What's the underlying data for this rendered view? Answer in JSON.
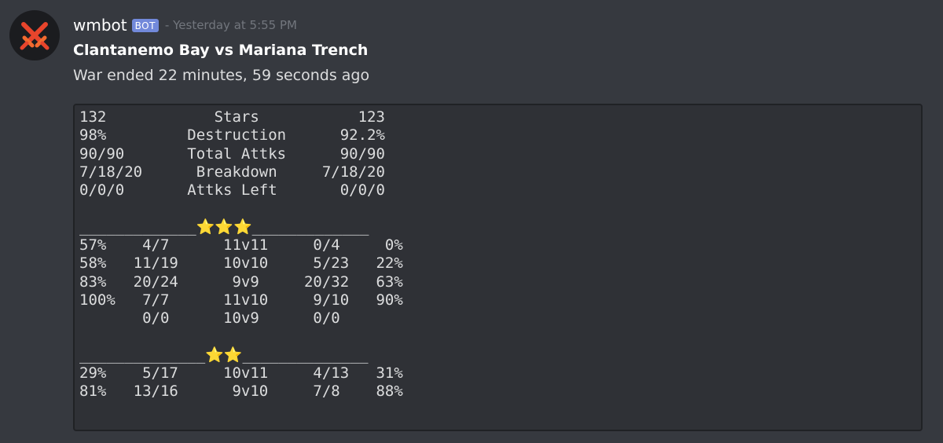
{
  "message": {
    "author": "wmbot",
    "bot_tag": "BOT",
    "timestamp": "- Yesterday at 5:55 PM",
    "avatar_icon": "crossed-swords-icon",
    "avatar_colors": [
      "#e8452c",
      "#f26a2f"
    ]
  },
  "embed": {
    "title": "Clantanemo Bay vs Mariana Trench",
    "description": "War ended 22 minutes, 59 seconds ago",
    "code_lines": [
      "132            Stars           123",
      "98%         Destruction      92.2%",
      "90/90       Total Attks      90/90",
      "7/18/20      Breakdown     7/18/20",
      "0/0/0       Attks Left       0/0/0",
      "",
      "_____________⭐⭐⭐_____________",
      "57%    4/7      11v11     0/4     0%",
      "58%   11/19     10v10     5/23   22%",
      "83%   20/24      9v9     20/32   63%",
      "100%   7/7      11v10     9/10   90%",
      "       0/0      10v9      0/0",
      "",
      "______________⭐⭐______________",
      "29%    5/17     10v11     4/13   31%",
      "81%   13/16      9v10     7/8    88%"
    ]
  },
  "colors": {
    "background": "#36393f",
    "code_background": "#2f3136",
    "bot_tag": "#7289da",
    "timestamp": "#72767d",
    "star": "#f9c62c"
  }
}
